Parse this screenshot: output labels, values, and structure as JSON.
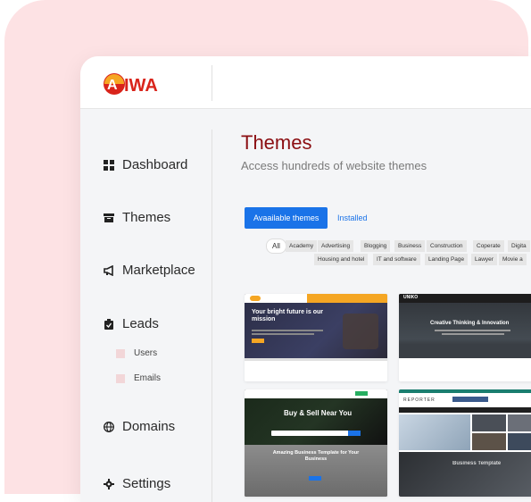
{
  "brand": {
    "logo_text": "AIWA"
  },
  "sidebar": {
    "items": [
      {
        "label": "Dashboard",
        "icon": "grid-icon"
      },
      {
        "label": "Themes",
        "icon": "archive-icon"
      },
      {
        "label": "Marketplace",
        "icon": "megaphone-icon"
      },
      {
        "label": "Leads",
        "icon": "clipboard-icon"
      },
      {
        "label": "Domains",
        "icon": "globe-icon"
      },
      {
        "label": "Settings",
        "icon": "gear-icon"
      }
    ],
    "sub_items": [
      {
        "label": "Users"
      },
      {
        "label": "Emails"
      }
    ]
  },
  "main": {
    "title": "Themes",
    "subtitle": "Access hundreds of website themes",
    "tabs": [
      {
        "label": "Avaailable themes",
        "active": true
      },
      {
        "label": "Installed",
        "active": false
      }
    ],
    "categories_row1": [
      "All",
      "Academy",
      "Advertising",
      "Blogging",
      "Business",
      "Construction",
      "Coperate",
      "Digita"
    ],
    "categories_row2": [
      "Housing and hotel",
      "IT and software",
      "Landing Page",
      "Lawyer",
      "Movie a"
    ],
    "themes": [
      {
        "headline": "Your bright future is our mission",
        "cta": "Get Started"
      },
      {
        "brand": "UNIKO",
        "headline": "Creative Thinking & Innovation"
      },
      {
        "headline": "Buy & Sell Near You",
        "subheadline": "Amazing Business Template for Your Business"
      },
      {
        "brand": "REPORTER",
        "headline": "Business Template"
      }
    ]
  },
  "colors": {
    "accent": "#8b0e12",
    "primary": "#1a73e8",
    "background": "#fde2e4"
  }
}
